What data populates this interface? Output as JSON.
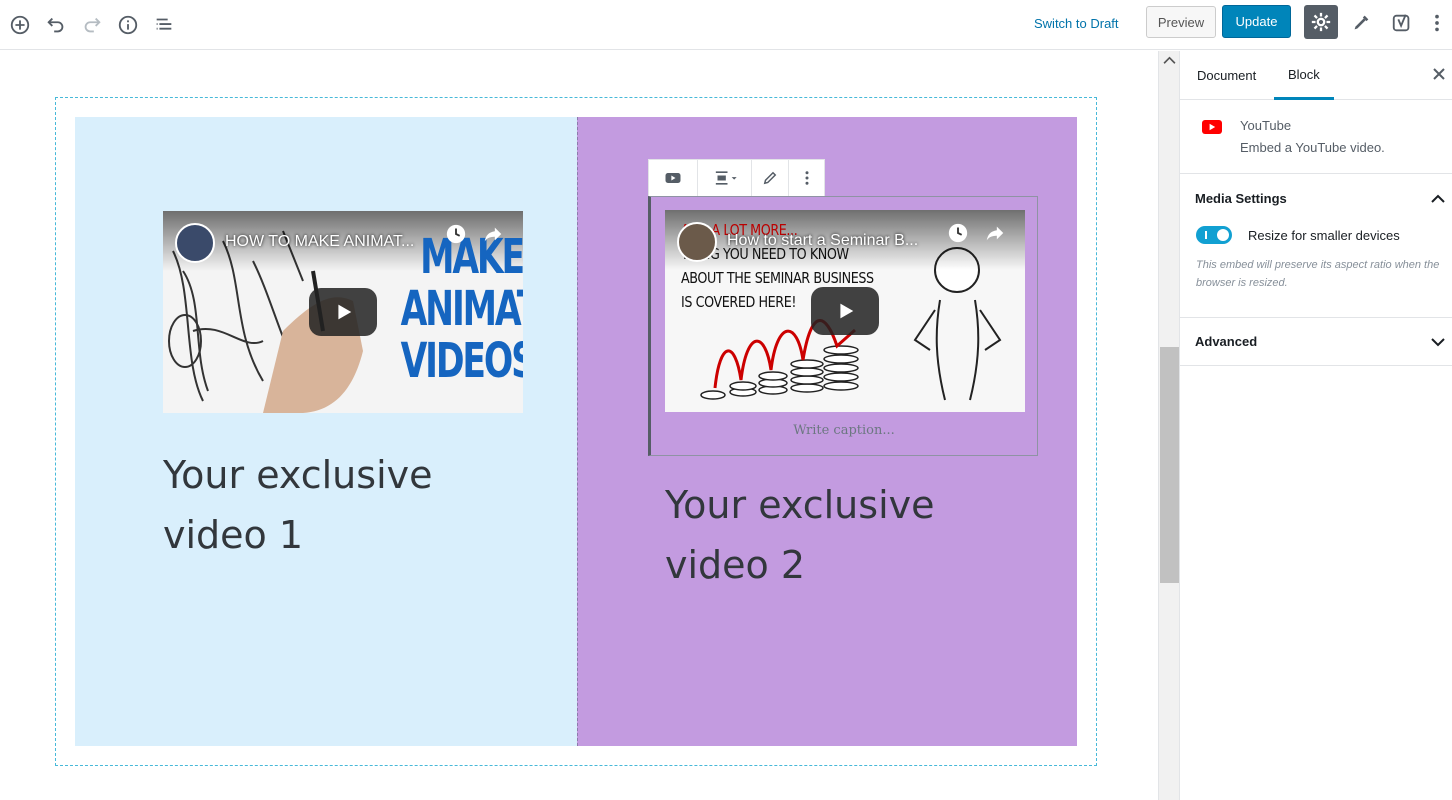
{
  "toolbar": {
    "switch_to_draft": "Switch to Draft",
    "preview": "Preview",
    "update": "Update",
    "left_icons": [
      "add-block-icon",
      "undo-icon",
      "redo-icon",
      "info-icon",
      "outline-icon"
    ],
    "right_icons": [
      "settings-gear-icon",
      "plugin-pen-icon",
      "yoast-icon",
      "more-menu-icon"
    ]
  },
  "content": {
    "column1": {
      "video_title": "HOW TO MAKE ANIMAT...",
      "thumb_text": [
        "MAKE",
        "ANIMATED",
        "VIDEOS!"
      ],
      "heading_line1": "Your exclusive",
      "heading_line2": "video 1",
      "bg": "#d9effc"
    },
    "column2": {
      "video_title": "How to start a Seminar B...",
      "thumb_text": [
        "AND A LOT MORE...",
        "THING YOU NEED TO KNOW",
        "ABOUT THE SEMINAR BUSINESS",
        "IS COVERED HERE!"
      ],
      "caption_placeholder": "Write caption...",
      "heading_line1": "Your exclusive",
      "heading_line2": "video 2",
      "bg": "#c39be0"
    }
  },
  "sidebar": {
    "tabs": [
      "Document",
      "Block"
    ],
    "active_tab": "Block",
    "block_name": "YouTube",
    "block_desc": "Embed a YouTube video.",
    "media_settings_title": "Media Settings",
    "toggle_label": "Resize for smaller devices",
    "toggle_on": true,
    "toggle_help": "This embed will preserve its aspect ratio when the browser is resized.",
    "advanced_title": "Advanced"
  },
  "colors": {
    "accent": "#0085ba",
    "link": "#0073aa",
    "youtube_red": "#ff0000"
  }
}
